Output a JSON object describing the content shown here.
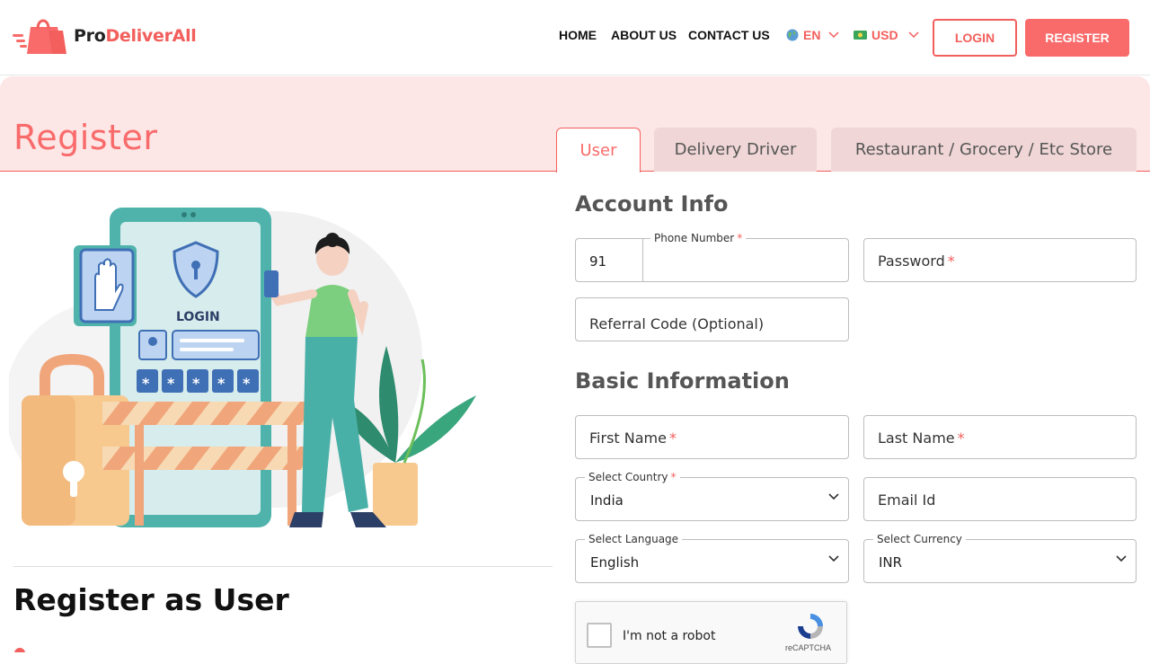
{
  "brand": {
    "name_part1": "Pro",
    "name_part2": "DeliverAll"
  },
  "nav": {
    "home": "HOME",
    "about": "ABOUT US",
    "contact": "CONTACT US",
    "language": "EN",
    "currency": "USD",
    "login": "LOGIN",
    "register": "REGISTER"
  },
  "banner": {
    "title": "Register",
    "tabs": [
      "User",
      "Delivery Driver",
      "Restaurant / Grocery / Etc Store"
    ]
  },
  "left": {
    "illustration_text": "LOGIN",
    "heading": "Register as User"
  },
  "form": {
    "account_title": "Account Info",
    "phone_label": "Phone Number",
    "phone_code": "91",
    "password_placeholder": "Password",
    "referral_placeholder": "Referral Code (Optional)",
    "basic_title": "Basic Information",
    "first_name_placeholder": "First Name",
    "last_name_placeholder": "Last Name",
    "country_label": "Select Country",
    "country_value": "India",
    "email_placeholder": "Email Id",
    "language_label": "Select Language",
    "language_value": "English",
    "currency_label": "Select Currency",
    "currency_value": "INR",
    "captcha_text": "I'm not a robot",
    "captcha_brand": "reCAPTCHA"
  },
  "colors": {
    "accent": "#f96b6b",
    "accent_dark": "#f25f5c",
    "banner_bg": "#fde6e6",
    "tab_bg": "#f0d6d6"
  }
}
